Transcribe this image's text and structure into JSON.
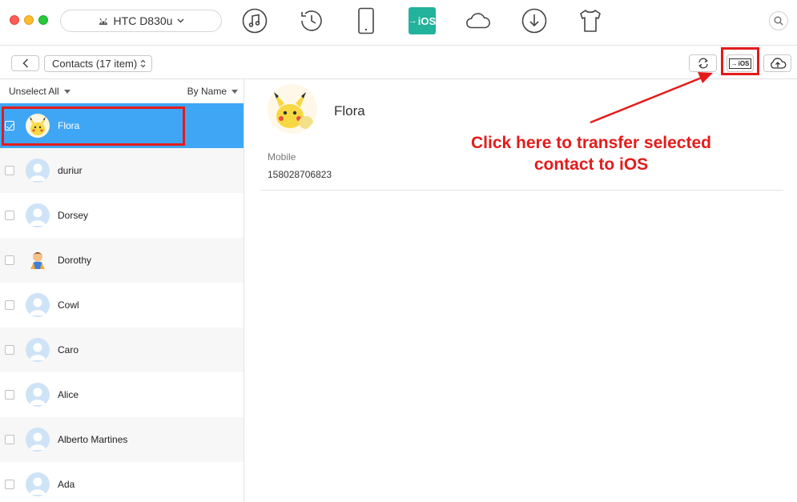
{
  "window": {
    "device_name": "HTC D830u",
    "nav_icons": [
      "music-icon",
      "history-icon",
      "phone-icon",
      "to-ios-icon",
      "cloud-icon",
      "download-icon",
      "tshirt-icon"
    ],
    "active_nav_label": "iOS"
  },
  "toolbar": {
    "category_select": "Contacts (17 item)",
    "to_ios_label": "iOS"
  },
  "list": {
    "unselect_all": "Unselect All",
    "sort_by": "By Name",
    "rows": [
      {
        "name": "Flora",
        "checked": true,
        "avatar": "pikachu"
      },
      {
        "name": "duriur",
        "checked": false,
        "avatar": "default"
      },
      {
        "name": "Dorsey",
        "checked": false,
        "avatar": "default"
      },
      {
        "name": "Dorothy",
        "checked": false,
        "avatar": "cartoon"
      },
      {
        "name": "Cowl",
        "checked": false,
        "avatar": "default"
      },
      {
        "name": "Caro",
        "checked": false,
        "avatar": "default"
      },
      {
        "name": "Alice",
        "checked": false,
        "avatar": "default"
      },
      {
        "name": "Alberto Martines",
        "checked": false,
        "avatar": "default"
      },
      {
        "name": "Ada",
        "checked": false,
        "avatar": "default"
      }
    ]
  },
  "detail": {
    "name": "Flora",
    "mobile_label": "Mobile",
    "mobile_value": "158028706823"
  },
  "annotation": {
    "line1": "Click here to transfer selected",
    "line2": "contact to iOS",
    "color": "#e41b1b"
  },
  "colors": {
    "selected_row": "#3fa6f6",
    "active_nav": "#23b29b"
  }
}
